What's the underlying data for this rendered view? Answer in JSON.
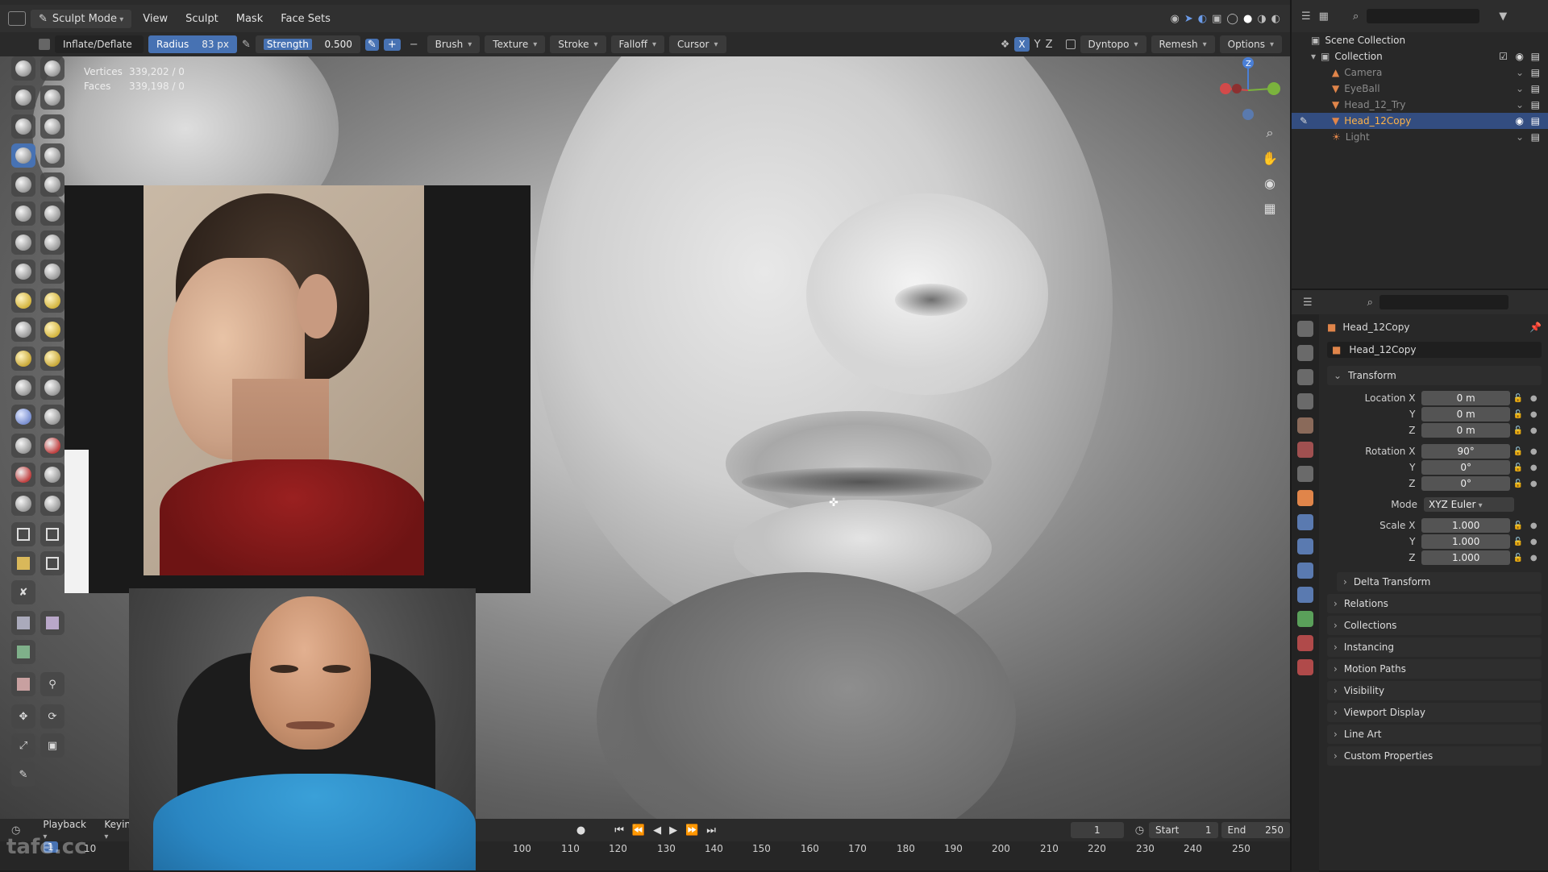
{
  "header": {
    "mode": "Sculpt Mode",
    "menus": [
      "View",
      "Sculpt",
      "Mask",
      "Face Sets"
    ],
    "viewport_axes": [
      "X",
      "Y",
      "Z"
    ],
    "dyntopo": "Dyntopo",
    "remesh": "Remesh",
    "options": "Options"
  },
  "tool_header": {
    "brush_name": "Inflate/Deflate",
    "radius_label": "Radius",
    "radius_value": "83 px",
    "strength_label": "Strength",
    "strength_value": "0.500",
    "dropdowns": [
      "Brush",
      "Texture",
      "Stroke",
      "Falloff",
      "Cursor"
    ]
  },
  "stats": {
    "vertices_label": "Vertices",
    "vertices_value": "339,202 / 0",
    "faces_label": "Faces",
    "faces_value": "339,198 / 0"
  },
  "timeline": {
    "playback": "Playback",
    "keying": "Keying",
    "current_frame": "1",
    "start_label": "Start",
    "start_value": "1",
    "end_label": "End",
    "end_value": "250",
    "ruler_ticks": [
      "100",
      "110",
      "120",
      "130",
      "140",
      "150",
      "160",
      "170",
      "180",
      "190",
      "200",
      "210",
      "220",
      "230",
      "240",
      "250"
    ],
    "frame_marker": "1",
    "partial_tick": "10"
  },
  "watermark": "tafe.cc",
  "outliner": {
    "scene_collection": "Scene Collection",
    "collection": "Collection",
    "items": [
      {
        "name": "Camera",
        "selected": false
      },
      {
        "name": "EyeBall",
        "selected": false
      },
      {
        "name": "Head_12_Try",
        "selected": false
      },
      {
        "name": "Head_12Copy",
        "selected": true
      },
      {
        "name": "Light",
        "selected": false
      }
    ]
  },
  "properties": {
    "object_name": "Head_12Copy",
    "object_datablock": "Head_12Copy",
    "transform_label": "Transform",
    "location": {
      "label": "Location X",
      "x": "0 m",
      "y": "0 m",
      "z": "0 m"
    },
    "rotation": {
      "label": "Rotation X",
      "x": "90°",
      "y": "0°",
      "z": "0°"
    },
    "mode_label": "Mode",
    "mode_value": "XYZ Euler",
    "scale": {
      "label": "Scale X",
      "x": "1.000",
      "y": "1.000",
      "z": "1.000"
    },
    "axis_y": "Y",
    "axis_z": "Z",
    "sections": [
      "Delta Transform",
      "Relations",
      "Collections",
      "Instancing",
      "Motion Paths",
      "Visibility",
      "Viewport Display",
      "Line Art",
      "Custom Properties"
    ]
  },
  "colors": {
    "accent_blue": "#4772b3",
    "selected_row": "#334d80",
    "panel_bg": "#282828"
  }
}
